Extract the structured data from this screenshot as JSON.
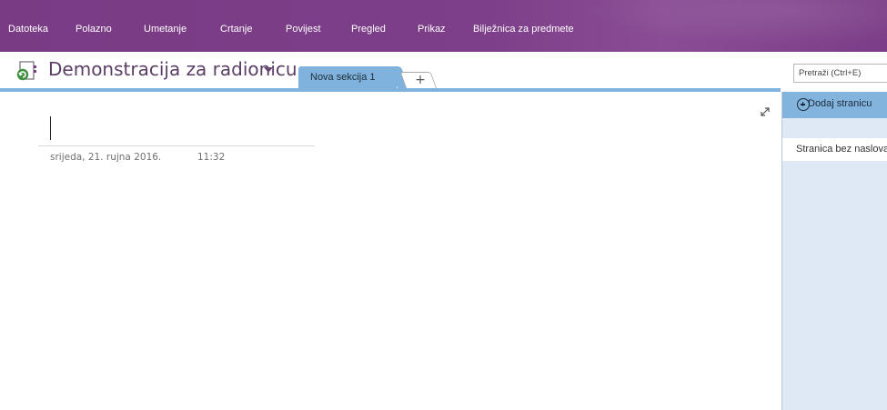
{
  "ribbon": {
    "tabs": [
      {
        "label": "Datoteka"
      },
      {
        "label": "Polazno"
      },
      {
        "label": "Umetanje"
      },
      {
        "label": "Crtanje"
      },
      {
        "label": "Povijest"
      },
      {
        "label": "Pregled"
      },
      {
        "label": "Prikaz"
      },
      {
        "label": "Bilježnica za predmete"
      }
    ]
  },
  "notebook": {
    "title": "Demonstracija za radionicu",
    "icon": "notebook-icon",
    "dropdown_icon": "caret-down-icon"
  },
  "sections": {
    "tabs": [
      {
        "label": "Nova sekcija 1",
        "color": "#7fb2dc"
      }
    ],
    "add_tab_glyph": "+"
  },
  "search": {
    "placeholder": "Pretraži (Ctrl+E)"
  },
  "pages_pane": {
    "add_page_label": "Dodaj stranicu",
    "pages": [
      {
        "label": "Stranica bez naslova"
      }
    ]
  },
  "page": {
    "date": "srijeda, 21. rujna 2016.",
    "time": "11:32",
    "expand_icon": "expand-icon"
  },
  "colors": {
    "ribbon": "#7b3d87",
    "section_accent": "#7fb2dc",
    "pane_background": "#dfe9f6"
  }
}
